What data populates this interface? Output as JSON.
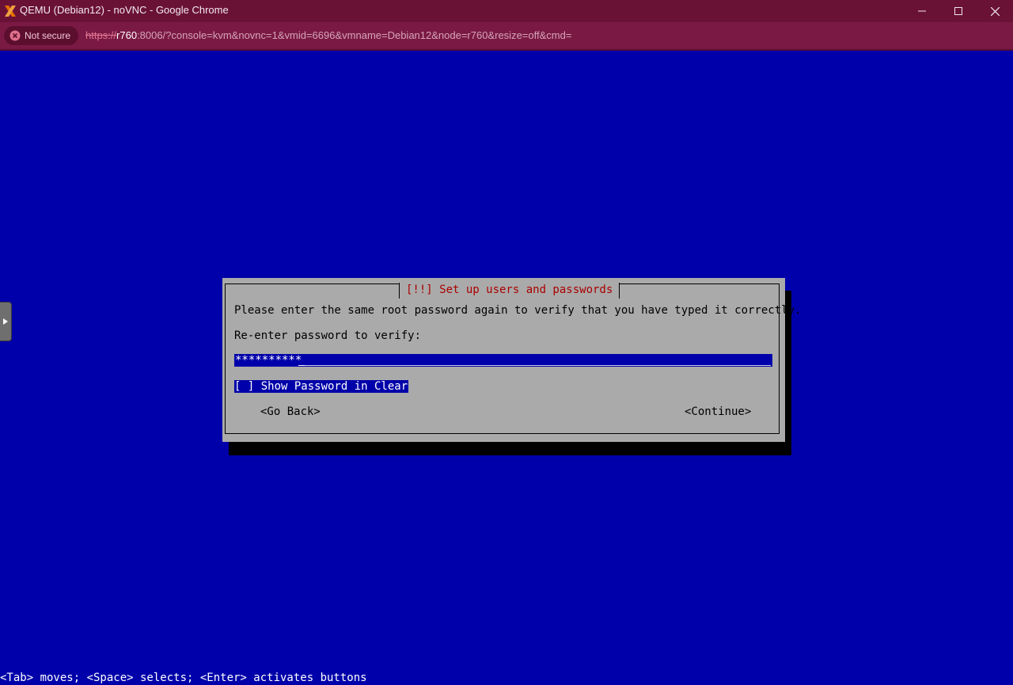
{
  "browser": {
    "window_title": "QEMU (Debian12) - noVNC - Google Chrome",
    "security_label": "Not secure",
    "url_scheme": "https://",
    "url_host": "r760",
    "url_rest": ":8006/?console=kvm&novnc=1&vmid=6696&vmname=Debian12&node=r760&resize=off&cmd=",
    "colors": {
      "titlebar": "#6A1236",
      "addressbar": "#7A1A44"
    }
  },
  "icons": {
    "app": "proxmox-x-icon",
    "security": "not-secure-icon",
    "minimize": "minimize-icon",
    "maximize": "maximize-icon",
    "close": "close-icon",
    "novnc_handle": "expand-arrow-icon"
  },
  "installer": {
    "background_color": "#0000AA",
    "dialog": {
      "title": "[!!] Set up users and passwords",
      "instruction": "Please enter the same root password again to verify that you have typed it correctly.",
      "field_label": "Re-enter password to verify:",
      "password_mask": "**********",
      "show_password_checkbox": "[ ] Show Password in Clear",
      "go_back_button": "<Go Back>",
      "continue_button": "<Continue>"
    },
    "help_line": "<Tab> moves; <Space> selects; <Enter> activates buttons"
  }
}
